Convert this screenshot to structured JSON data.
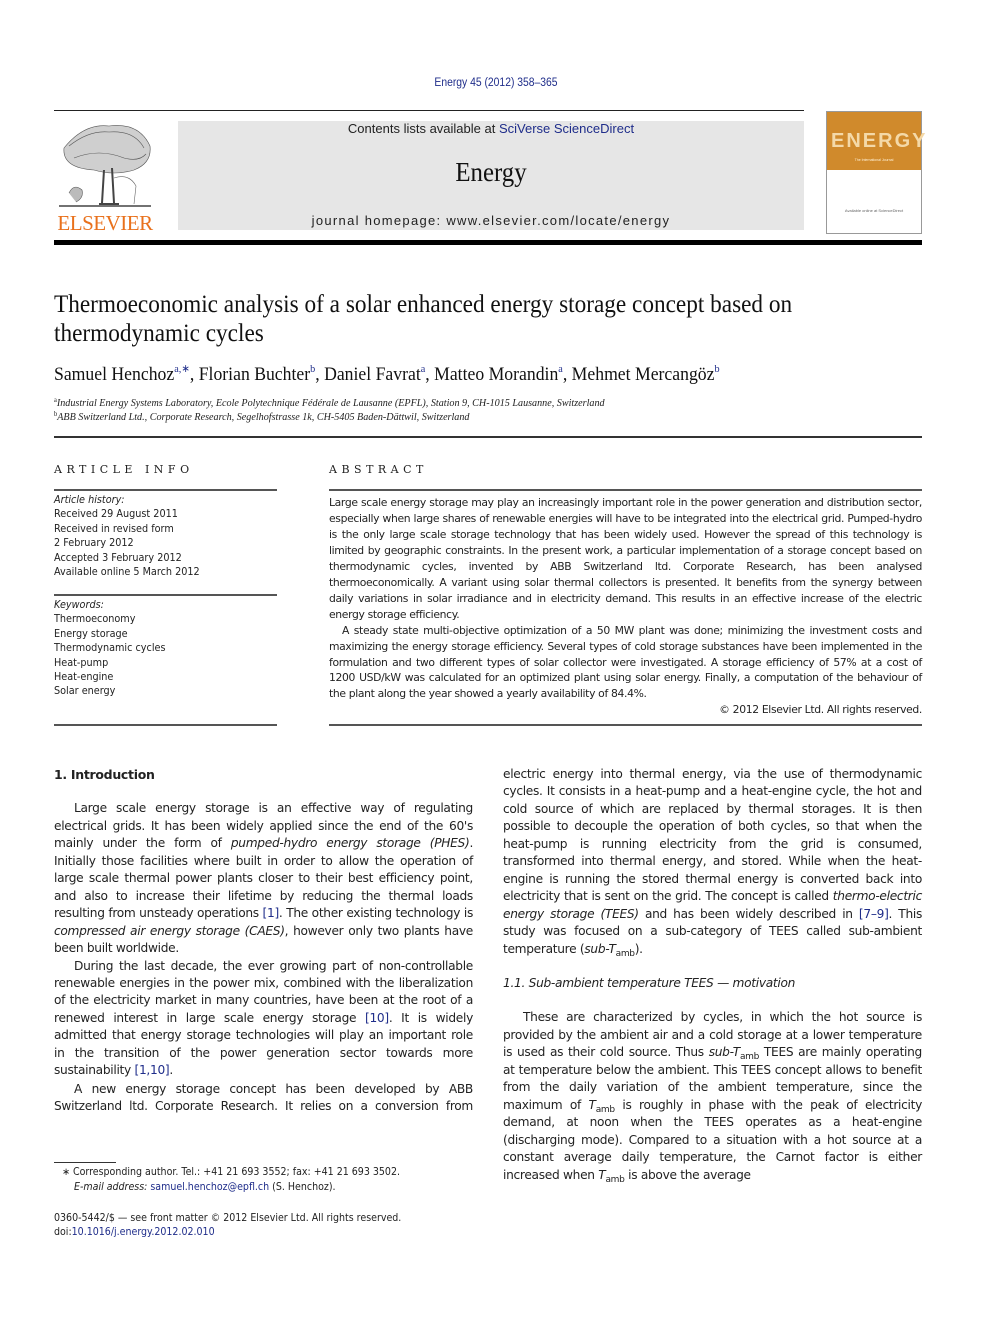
{
  "header": {
    "citation": "Energy 45 (2012) 358–365",
    "publisher_logo_text": "ELSEVIER",
    "contents_prefix": "Contents lists available at ",
    "contents_link": "SciVerse ScienceDirect",
    "journal_name": "Energy",
    "homepage": "journal homepage: www.elsevier.com/locate/energy",
    "cover_title": "ENERGY",
    "cover_subtitle": "The International Journal",
    "cover_footer": "Available online at ScienceDirect",
    "colors": {
      "elsevier_orange": "#e9711c",
      "link_blue": "#1f2d8a",
      "masthead_gray": "#e6e6e6",
      "cover_orange": "#d08a2c"
    }
  },
  "article": {
    "title_line1": "Thermoeconomic analysis of a solar enhanced energy storage concept based on",
    "title_line2": "thermodynamic cycles",
    "authors": [
      {
        "name": "Samuel Henchoz",
        "sup": "a,∗",
        "sep": ", "
      },
      {
        "name": "Florian Buchter",
        "sup": "b",
        "sep": ", "
      },
      {
        "name": "Daniel Favrat",
        "sup": "a",
        "sep": ", "
      },
      {
        "name": "Matteo Morandin",
        "sup": "a",
        "sep": ", "
      },
      {
        "name": "Mehmet Mercangöz",
        "sup": "b",
        "sep": ""
      }
    ],
    "affiliations": [
      {
        "mark": "a",
        "text": "Industrial Energy Systems Laboratory, Ecole Polytechnique Fédérale de Lausanne (EPFL), Station 9, CH-1015 Lausanne, Switzerland"
      },
      {
        "mark": "b",
        "text": "ABB Switzerland Ltd., Corporate Research, Segelhofstrasse 1k, CH-5405 Baden-Dättwil, Switzerland"
      }
    ]
  },
  "article_info": {
    "heading": "ARTICLE INFO",
    "history_label": "Article history:",
    "history": [
      "Received 29 August 2011",
      "Received in revised form",
      "2 February 2012",
      "Accepted 3 February 2012",
      "Available online 5 March 2012"
    ],
    "keywords_label": "Keywords:",
    "keywords": [
      "Thermoeconomy",
      "Energy storage",
      "Thermodynamic cycles",
      "Heat-pump",
      "Heat-engine",
      "Solar energy"
    ]
  },
  "abstract": {
    "heading": "ABSTRACT",
    "para1": "Large scale energy storage may play an increasingly important role in the power generation and distribution sector, especially when large shares of renewable energies will have to be integrated into the electrical grid. Pumped-hydro is the only large scale storage technology that has been widely used. However the spread of this technology is limited by geographic constraints. In the present work, a particular implementation of a storage concept based on thermodynamic cycles, invented by ABB Switzerland ltd. Corporate Research, has been analysed thermoeconomically. A variant using solar thermal collectors is presented. It benefits from the synergy between daily variations in solar irradiance and in electricity demand. This results in an effective increase of the electric energy storage efficiency.",
    "para2": "A steady state multi-objective optimization of a 50 MW plant was done; minimizing the investment costs and maximizing the energy storage efficiency. Several types of cold storage substances have been implemented in the formulation and two different types of solar collector were investigated. A storage efficiency of 57% at a cost of 1200 USD/kW was calculated for an optimized plant using solar energy. Finally, a computation of the behaviour of the plant along the year showed a yearly availability of 84.4%.",
    "copyright": "© 2012 Elsevier Ltd. All rights reserved."
  },
  "body": {
    "section1_heading": "1.  Introduction",
    "p1": {
      "t1": "Large scale energy storage is an effective way of regulating electrical grids. It has been widely applied since the end of the 60's mainly under the form of ",
      "i1": "pumped-hydro energy storage (PHES)",
      "t2": ". Initially those facilities where built in order to allow the operation of large scale thermal power plants closer to their best efficiency point, and also to increase their lifetime by reducing the thermal loads resulting from unsteady operations ",
      "ref1": "[1]",
      "t3": ". The other existing technology is ",
      "i2": "compressed air energy storage (CAES)",
      "t4": ", however only two plants have been built worldwide."
    },
    "p2": {
      "t1": "During the last decade, the ever growing part of non-controllable renewable energies in the power mix, combined with the liberalization of the electricity market in many countries, have been at the root of a renewed interest in large scale energy storage ",
      "ref1": "[10]",
      "t2": ". It is widely admitted that energy storage technologies will play an important role in the transition of the power generation sector towards more sustainability ",
      "ref2": "[1,10]",
      "t3": "."
    },
    "p3": {
      "t1": "A new energy storage concept has been developed by ABB Switzerland ltd. Corporate Research. It relies on a conversion from electric energy into thermal energy, via the use of thermodynamic cycles. It consists in a heat-pump and a heat-engine cycle, the hot and cold source of which are replaced by thermal storages. It is then possible to decouple the operation of both cycles, so that when the heat-pump is running electricity from the grid is consumed, transformed into thermal energy, and stored. While when the heat-engine is running the stored thermal energy is converted back into electricity that is sent on the grid. The concept is called ",
      "i1": "thermo-electric energy storage (TEES)",
      "t2": " and has been widely described in ",
      "ref1": "[7–9]",
      "t3": ". This study was focused on a sub-category of TEES called sub-ambient temperature (",
      "i2": "sub-T",
      "sub1": "amb",
      "t4": ")."
    },
    "subsection_heading": "1.1.  Sub-ambient temperature TEES — motivation",
    "p4": {
      "t1": "These are characterized by cycles, in which the hot source is provided by the ambient air and a cold storage at a lower temperature is used as their cold source. Thus ",
      "i1": "sub-T",
      "sub1": "amb",
      "t2": " TEES are mainly operating at temperature below the ambient. This TEES concept allows to benefit from the daily variation of the ambient temperature, since the maximum of ",
      "i2": "T",
      "sub2": "amb",
      "t3": " is roughly in phase with the peak of electricity demand, at noon when the TEES operates as a heat-engine (discharging mode). Compared to a situation with a hot source at a constant average daily temperature, the Carnot factor is either increased when ",
      "i3": "T",
      "sub3": "amb",
      "t4": " is above the average"
    }
  },
  "footnotes": {
    "corresponding": "∗  Corresponding author. Tel.: +41 21 693 3552; fax: +41 21 693 3502.",
    "email_label": "E-mail address: ",
    "email": "samuel.henchoz@epfl.ch",
    "email_suffix": " (S. Henchoz).",
    "front_matter": "0360-5442/$ — see front matter © 2012 Elsevier Ltd. All rights reserved.",
    "doi_prefix": "doi:",
    "doi": "10.1016/j.energy.2012.02.010"
  }
}
